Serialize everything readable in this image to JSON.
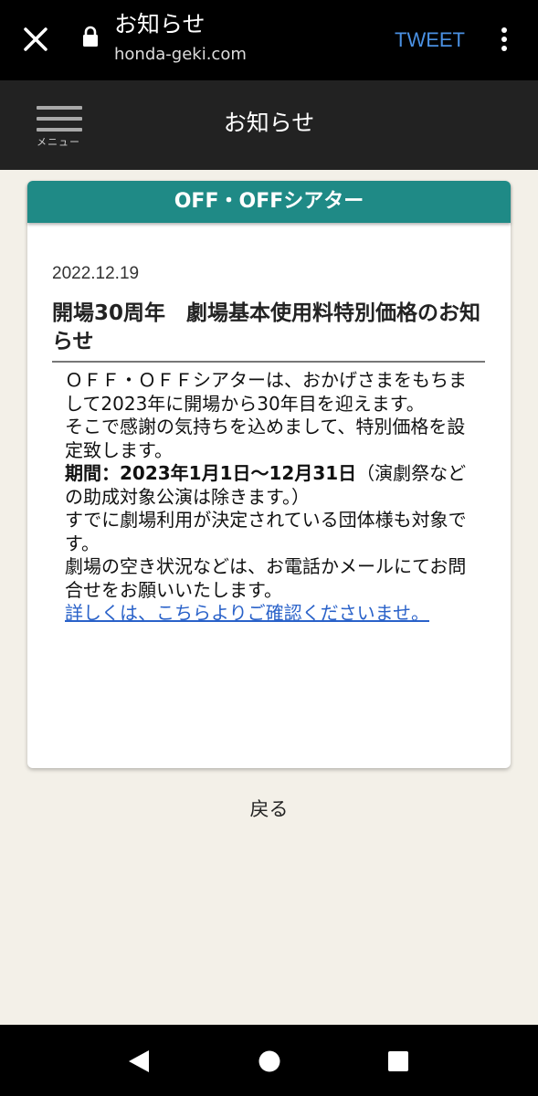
{
  "browser": {
    "title": "お知らせ",
    "url": "honda-geki.com",
    "tweet_label": "TWEET"
  },
  "header": {
    "menu_label": "メニュー",
    "title": "お知らせ"
  },
  "card": {
    "category": "OFF・OFFシアター",
    "date": "2022.12.19",
    "title": "開場30周年　劇場基本使用料特別価格のお知らせ",
    "body": {
      "p1": "ＯＦＦ・ＯＦＦシアターは、おかげさまをもちまして2023年に開場から30年目を迎えます。",
      "p2": "そこで感謝の気持ちを込めまして、特別価格を設定致します。",
      "p3_label": "期間：2023年1月1日～12月31日",
      "p3_rest": "（演劇祭などの助成対象公演は除きます。）",
      "p4": "すでに劇場利用が決定されている団体様も対象です。",
      "p5": "劇場の空き状況などは、お電話かメールにてお問合せをお願いいたします。",
      "link": "詳しくは、こちらよりご確認くださいませ。"
    }
  },
  "back_label": "戻る",
  "colors": {
    "accent": "#1f8a86",
    "header_bg": "#222222",
    "page_bg": "#f3f0e8",
    "link": "#2a62c9",
    "tweet": "#4a90e2"
  },
  "icons": {
    "close": "close-icon",
    "lock": "lock-icon",
    "more": "more-vert-icon",
    "menu": "hamburger-menu-icon",
    "nav_back": "nav-back-icon",
    "nav_home": "nav-home-icon",
    "nav_recents": "nav-recents-icon"
  }
}
